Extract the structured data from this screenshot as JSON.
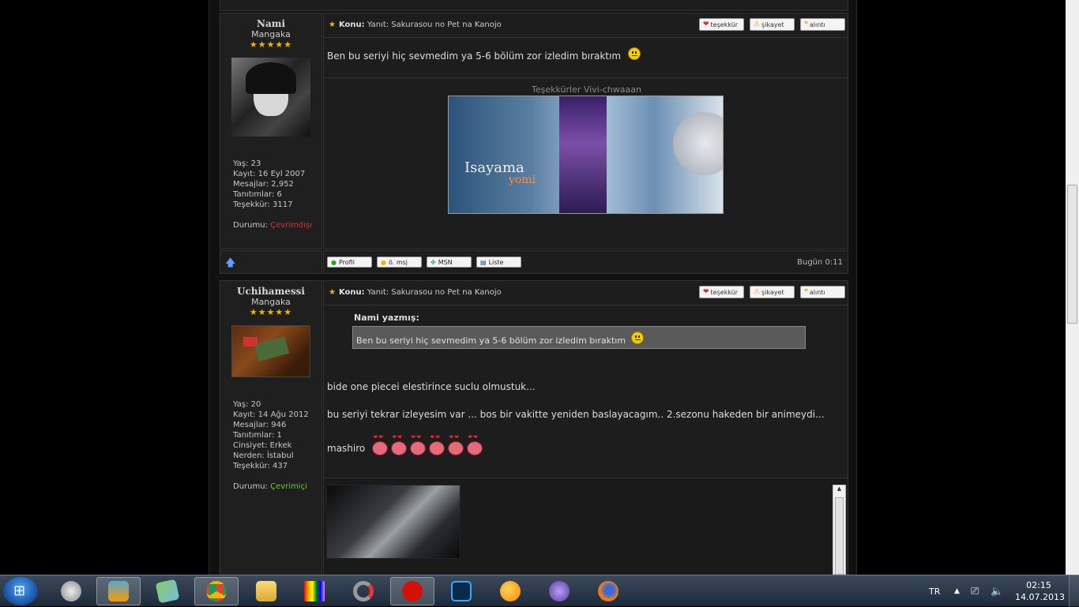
{
  "posts": [
    {
      "username": "Nami",
      "rank": "Mangaka",
      "stars": "★★★★★",
      "stats": [
        "Yaş: 23",
        "Kayıt: 16 Eyl 2007",
        "Mesajlar: 2,952",
        "Tanıtımlar: 6",
        "Teşekkür: 3117"
      ],
      "status_label": "Durumu:",
      "status_value": "Çevrimdışı",
      "topic_label": "Konu:",
      "topic_title": "Yanıt: Sakurasou no Pet na Kanojo",
      "body": "Ben bu seriyi hiç sevmedim ya 5-6 bölüm zor izledim bıraktım",
      "signature_caption": "Teşekkürler Vivi-chwaaan",
      "signature_banner_text": "Isayama",
      "signature_banner_sub": "yomi",
      "time": "Bugün 0:11"
    },
    {
      "username": "Uchihamessi",
      "rank": "Mangaka",
      "stars": "★★★★★",
      "stats": [
        "Yaş: 20",
        "Kayıt: 14 Ağu 2012",
        "Mesajlar: 946",
        "Tanıtımlar: 1",
        "Cinsiyet: Erkek",
        "Nerden: İstabul",
        "Teşekkür: 437"
      ],
      "status_label": "Durumu:",
      "status_value": "Çevrimiçi",
      "topic_label": "Konu:",
      "topic_title": "Yanıt: Sakurasou no Pet na Kanojo",
      "quote_author": "Nami yazmış:",
      "quote_text": "Ben bu seriyi hiç sevmedim ya 5-6 bölüm zor izledim bıraktım",
      "line1": "bide one piecei elestirince suclu olmustuk...",
      "line2": "bu seriyi tekrar izleyesim var ... bos bir vakitte yeniden baslayacagım.. 2.sezonu hakeden bir animeydi...",
      "line3": "mashiro"
    }
  ],
  "post_buttons": {
    "thanks": "teşekkür",
    "complain": "şikayet",
    "quote": "alıntı"
  },
  "link_buttons": {
    "profile": "Profil",
    "pm": "ö. msj",
    "msn": "MSN",
    "list": "Liste"
  },
  "taskbar": {
    "language": "TR",
    "time": "02:15",
    "date": "14.07.2013"
  }
}
